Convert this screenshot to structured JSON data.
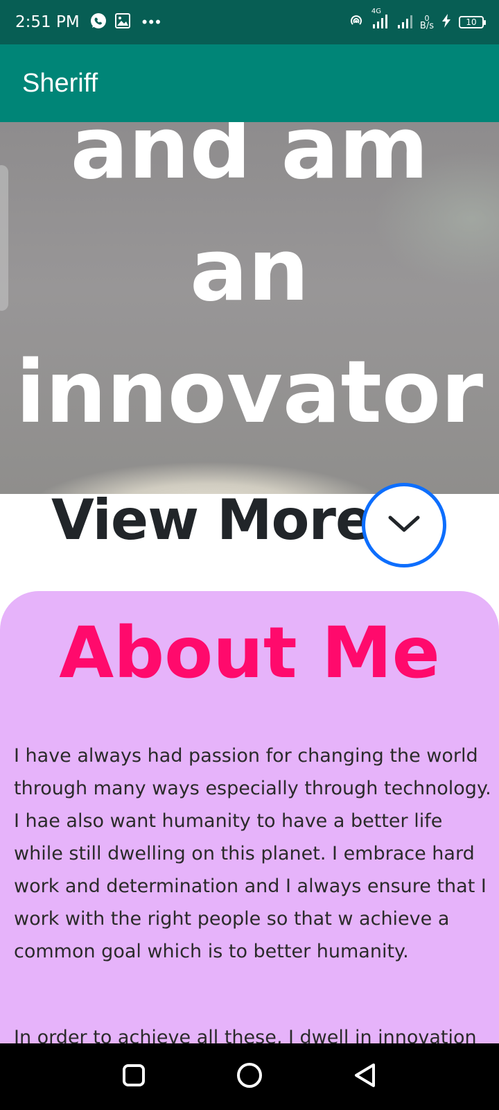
{
  "status_bar": {
    "time": "2:51 PM",
    "network_type": "4G",
    "data_rate_value": "0",
    "data_rate_unit": "B/s",
    "battery_level": "10",
    "icons": [
      "whatsapp-icon",
      "gallery-icon",
      "more-dots-icon",
      "hotspot-icon",
      "signal-icon",
      "signal-icon-2",
      "charging-icon",
      "battery-icon"
    ]
  },
  "app_bar": {
    "title": "Sheriff"
  },
  "hero": {
    "lines": [
      "and am",
      "an",
      "innovator"
    ]
  },
  "view_more": {
    "label": "View More",
    "icon": "chevron-down-icon",
    "accent": "#0d6efd"
  },
  "about": {
    "title": "About Me",
    "title_color": "#ff0a6c",
    "background": "#e6b3fa",
    "paragraph_1": "I have always had passion for changing the world through many ways especially through technology. I hae also want humanity to have a better life while still dwelling on this planet. I embrace hard work and determination and I always ensure that I work with the right people so that w achieve a common goal which is to better humanity.",
    "paragraph_2": "In order to achieve all these, I dwell in innovation"
  },
  "nav_bar": {
    "icons": [
      "recent-apps-icon",
      "home-icon",
      "back-icon"
    ]
  },
  "colors": {
    "status_bar": "#075e54",
    "app_bar": "#008577"
  }
}
